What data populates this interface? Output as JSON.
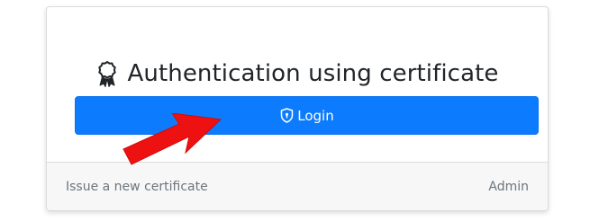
{
  "card": {
    "title": "Authentication using certificate",
    "title_icon": "certificate-award-icon",
    "login_button": {
      "label": "Login",
      "icon": "shield-lock-icon",
      "color": "#0d7bfd"
    }
  },
  "footer": {
    "issue_link": "Issue a new certificate",
    "admin_link": "Admin"
  },
  "annotation": {
    "arrow_color": "#ee1111"
  }
}
